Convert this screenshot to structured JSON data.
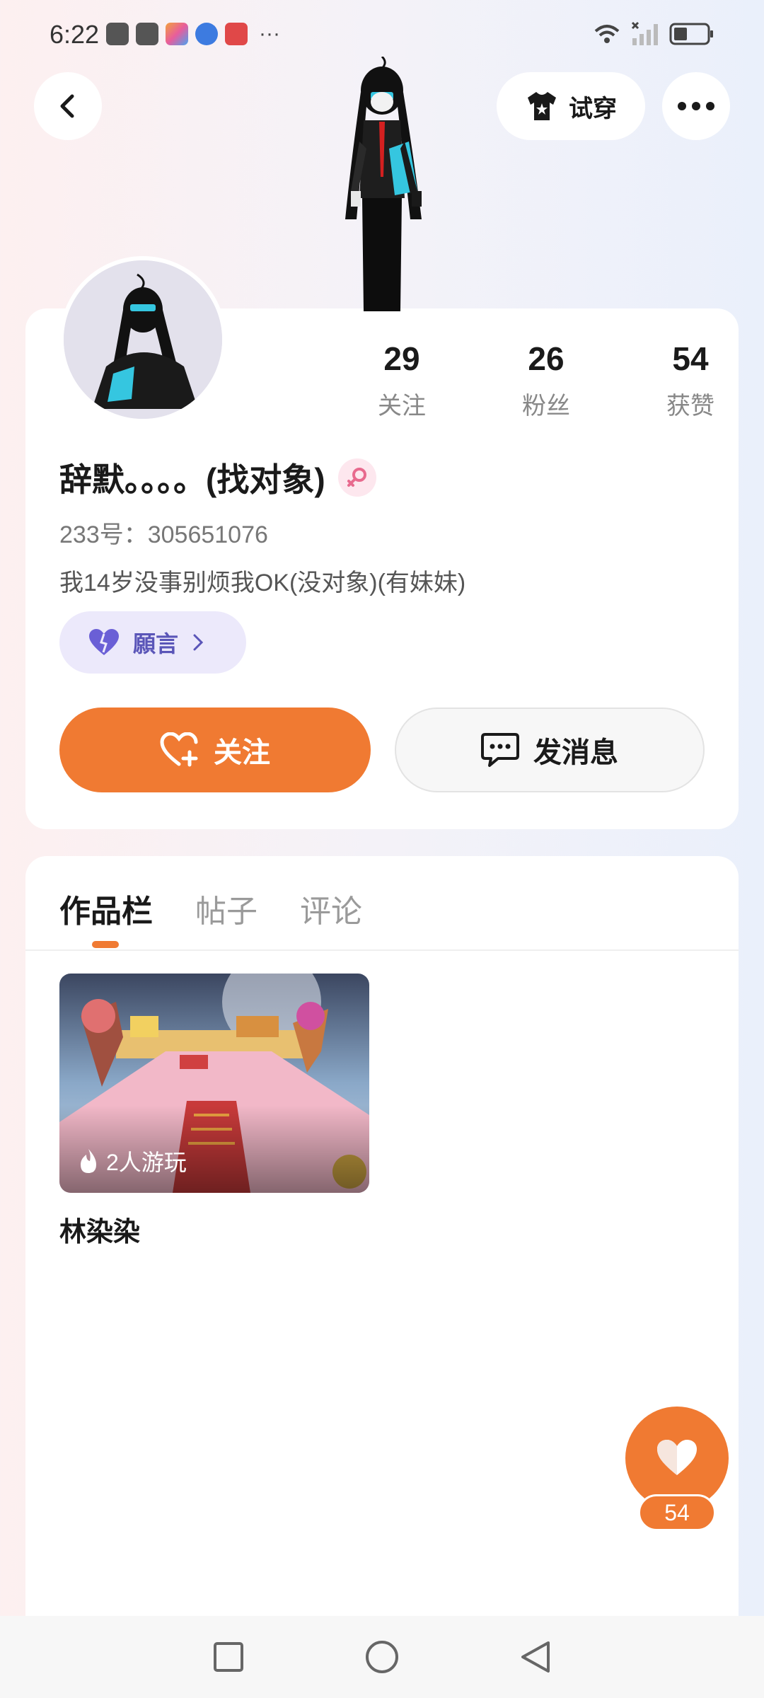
{
  "status_bar": {
    "time": "6:22",
    "app_icons": [
      {
        "name": "shopping-bag-icon",
        "color": "#555555"
      },
      {
        "name": "shopping-bag-icon",
        "color": "#555555"
      },
      {
        "name": "paintbrush-app-icon",
        "color": "#f2a23c"
      },
      {
        "name": "browser-app-icon",
        "color": "#3d7be0"
      },
      {
        "name": "book-app-icon",
        "color": "#e04848"
      }
    ],
    "more_glyph": "···"
  },
  "header": {
    "try_on_label": "试穿"
  },
  "profile": {
    "stats": [
      {
        "value": "29",
        "label": "关注"
      },
      {
        "value": "26",
        "label": "粉丝"
      },
      {
        "value": "54",
        "label": "获赞"
      }
    ],
    "username": "辞默。。。。(找对象)",
    "gender": "female",
    "user_id": "233号：305651076",
    "bio": "我14岁没事别烦我OK(没对象)(有妹妹)",
    "wish_label": "願言",
    "follow_label": "关注",
    "message_label": "发消息"
  },
  "works": {
    "tabs": [
      {
        "label": "作品栏",
        "active": true
      },
      {
        "label": "帖子",
        "active": false
      },
      {
        "label": "评论",
        "active": false
      }
    ],
    "items": [
      {
        "title": "林染染",
        "play_count": "2人游玩"
      }
    ]
  },
  "like_fab": {
    "count": "54"
  },
  "colors": {
    "accent": "#f07a32",
    "wish_bg": "#ece9fb",
    "wish_text": "#5a55b8"
  }
}
